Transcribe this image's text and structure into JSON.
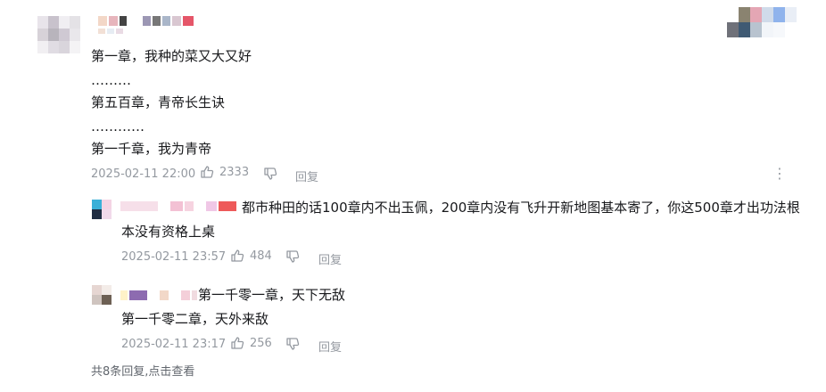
{
  "comment": {
    "lines": [
      "第一章，我种的菜又大又好",
      "………",
      "第五百章，青帝长生诀",
      "…………",
      "第一千章，我为青帝"
    ],
    "timestamp": "2025-02-11 22:00",
    "likes": "2333",
    "reply_label": "回复",
    "more_label": "⋮"
  },
  "replies": [
    {
      "lines": [
        "都市种田的话100章内不出玉佩，200章内没有飞升开新地图基本寄了，你这500章才出功法根",
        "本没有资格上桌"
      ],
      "timestamp": "2025-02-11 23:57",
      "likes": "484",
      "reply_label": "回复"
    },
    {
      "lines": [
        "第一千零一章，天下无敌",
        "第一千零二章，天外来敌"
      ],
      "timestamp": "2025-02-11 23:17",
      "likes": "256",
      "reply_label": "回复"
    }
  ],
  "footer": {
    "total_replies_prefix": "共8条回复,",
    "view_link": "点击查看"
  }
}
